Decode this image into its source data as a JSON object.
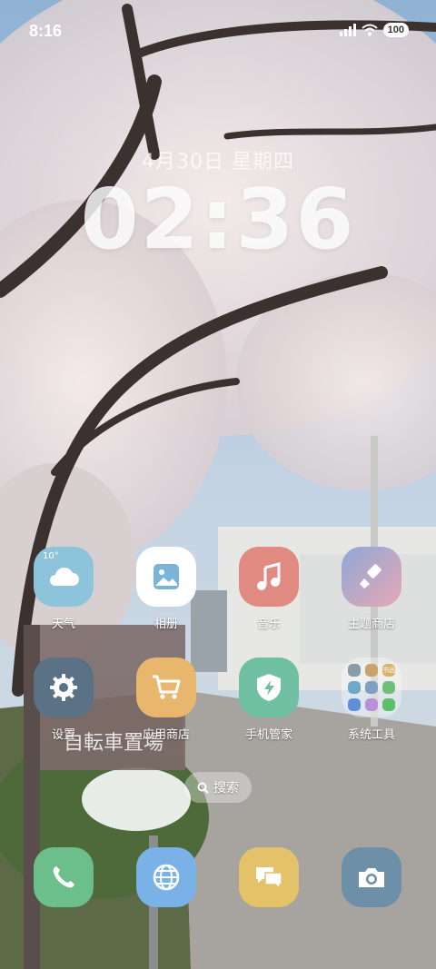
{
  "status_bar": {
    "time": "8:16",
    "battery": "100"
  },
  "lock_widget": {
    "date": "4月30日 星期四",
    "clock": "02:36"
  },
  "apps": {
    "weather": {
      "label": "天气",
      "temp": "10°"
    },
    "gallery": {
      "label": "相册"
    },
    "music": {
      "label": "音乐"
    },
    "themes": {
      "label": "主题商店"
    },
    "settings": {
      "label": "设置"
    },
    "app_store": {
      "label": "应用商店"
    },
    "phone_manager": {
      "label": "手机管家"
    },
    "system_tools": {
      "label": "系统工具",
      "badge": "书品"
    }
  },
  "search": {
    "label": "搜索"
  },
  "dock": [
    "phone-icon",
    "browser-icon",
    "messages-icon",
    "camera-icon"
  ],
  "colors": {
    "weather": "#8ec3dc",
    "gallery": "#ffffff",
    "music": "#e08a82",
    "themes": "#8fa8d8",
    "settings": "#5b7286",
    "app_store": "#e8b66c",
    "phone_manager": "#6fbfa3",
    "phone": "#6cbf8a",
    "browser": "#7ab2e8",
    "messages": "#e3c26a",
    "camera": "#6d8fa8"
  }
}
